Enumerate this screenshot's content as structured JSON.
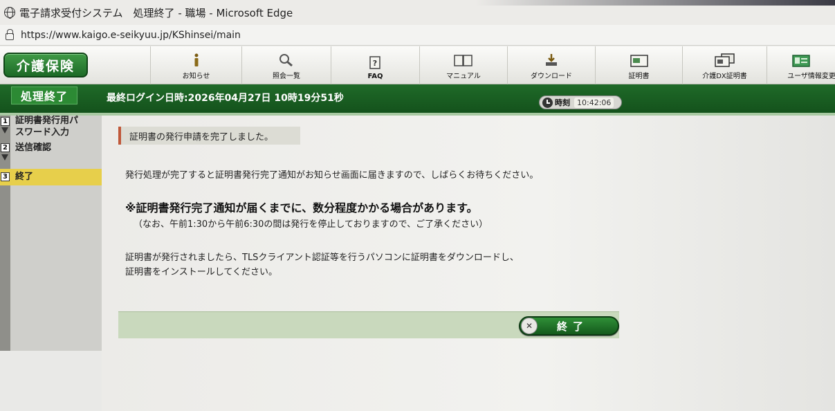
{
  "window": {
    "title": "電子請求受付システム　処理終了 - 職場 - Microsoft Edge",
    "url": "https://www.kaigo.e-seikyuu.jp/KShinsei/main"
  },
  "header": {
    "logo": "介護保険",
    "nav": [
      {
        "label": "お知らせ",
        "icon": "info-icon"
      },
      {
        "label": "照会一覧",
        "icon": "search-icon"
      },
      {
        "label": "FAQ",
        "icon": "faq-icon"
      },
      {
        "label": "マニュアル",
        "icon": "book-icon"
      },
      {
        "label": "ダウンロード",
        "icon": "download-icon"
      },
      {
        "label": "証明書",
        "icon": "certificate-icon"
      },
      {
        "label": "介護DX証明書",
        "icon": "dx-certificate-icon"
      },
      {
        "label": "ユーザ情報変更",
        "icon": "user-card-icon"
      }
    ]
  },
  "status": {
    "page": "処理終了",
    "last_login": "最終ログイン日時:2026年04月27日 10時19分51秒",
    "clock_label": "時刻",
    "clock_time": "10:42:06"
  },
  "sidebar": {
    "steps": [
      {
        "num": "1",
        "label_line1": "証明書発行用パ",
        "label_line2": "スワード入力"
      },
      {
        "num": "2",
        "label_line1": "送信確認"
      },
      {
        "num": "3",
        "label_line1": "終了"
      }
    ]
  },
  "main": {
    "notice": "証明書の発行申請を完了しました。",
    "message1": "発行処理が完了すると証明書発行完了通知がお知らせ画面に届きますので、しばらくお待ちください。",
    "message2": "※証明書発行完了通知が届くまでに、数分程度かかる場合があります。",
    "message3": "（なお、午前1:30から午前6:30の間は発行を停止しておりますので、ご了承ください）",
    "message4_line1": "証明書が発行されましたら、TLSクライアント認証等を行うパソコンに証明書をダウンロードし、",
    "message4_line2": "証明書をインストールしてください。",
    "end_button": "終了"
  }
}
